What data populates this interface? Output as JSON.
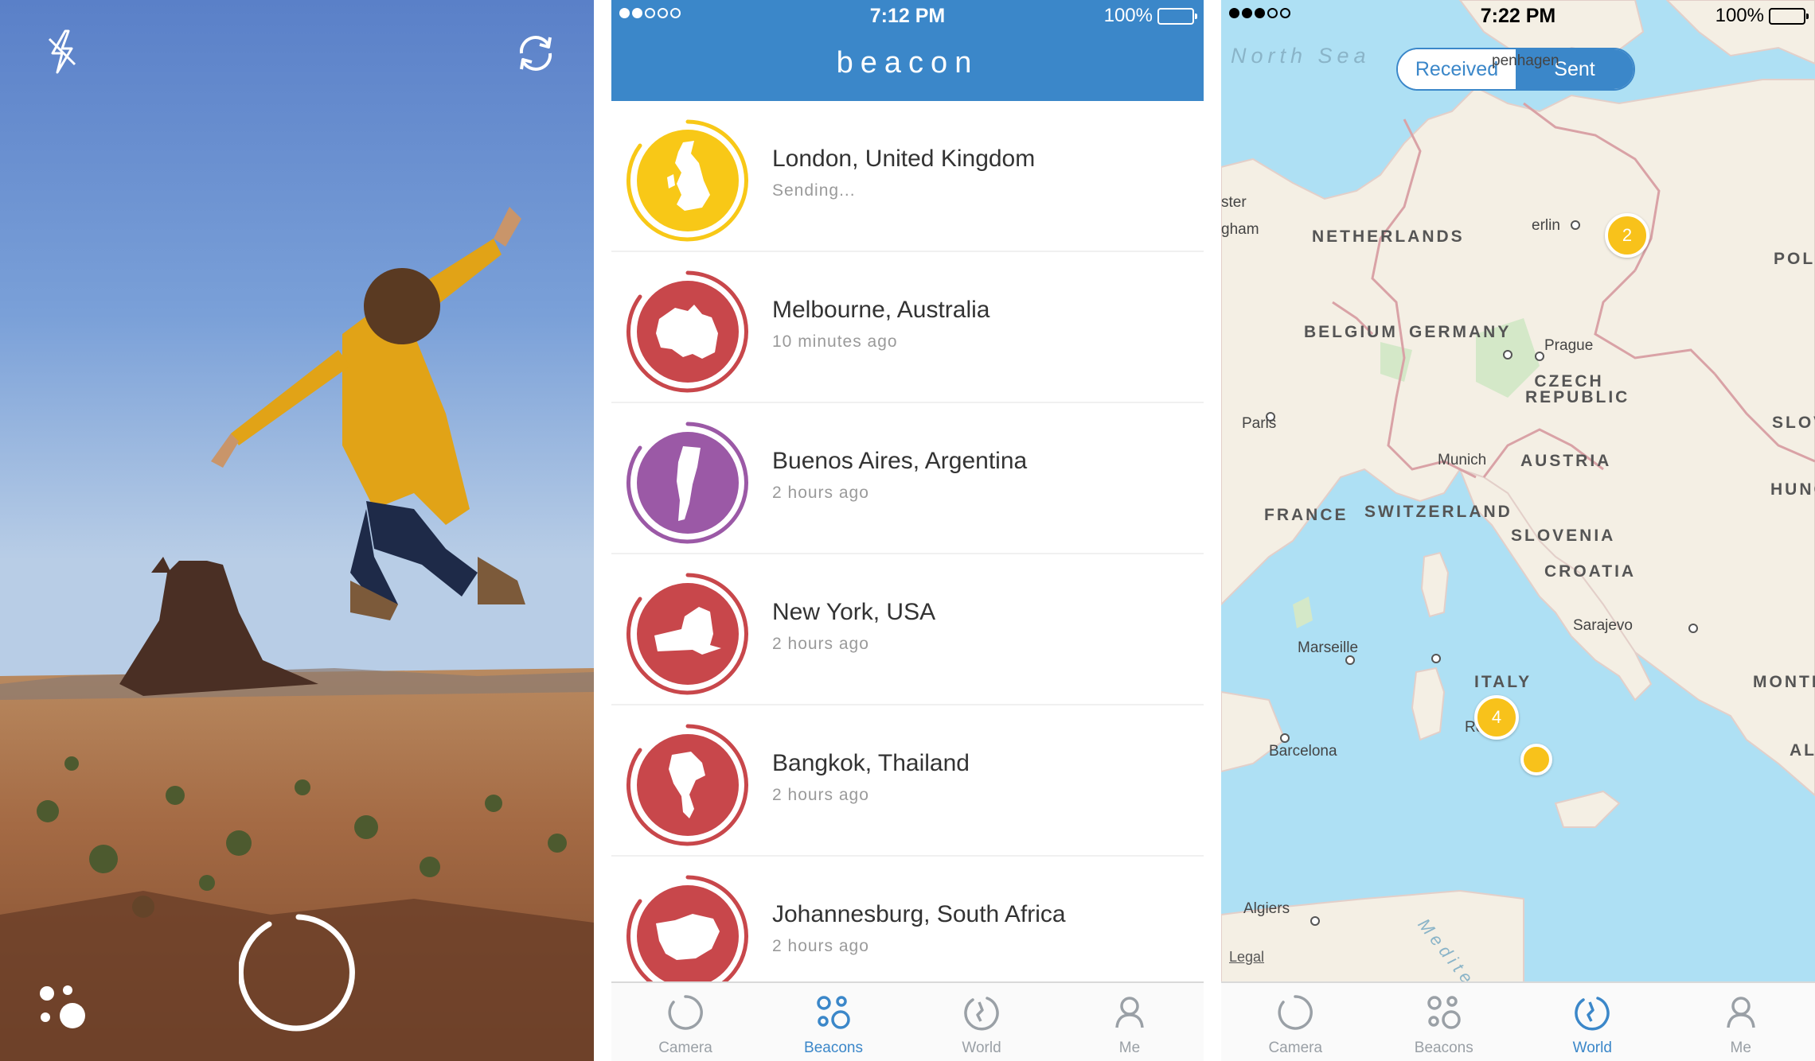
{
  "camera": {
    "icons": {
      "flash": "flash-off-icon",
      "flip": "camera-flip-icon",
      "shutter": "shutter-ring-icon",
      "filters": "filter-dots-icon"
    }
  },
  "beacons_screen": {
    "status_bar": {
      "time": "7:12 PM",
      "battery": "100%",
      "signal_bars": 2
    },
    "title": "beacon",
    "header_color": "#3b87c9",
    "items": [
      {
        "city": "London, United Kingdom",
        "sub": "Sending...",
        "color": "#f8c817",
        "icon": "united-kingdom-map-icon"
      },
      {
        "city": "Melbourne, Australia",
        "sub": "10 minutes ago",
        "color": "#c8474b",
        "icon": "australia-map-icon"
      },
      {
        "city": "Buenos Aires, Argentina",
        "sub": "2 hours ago",
        "color": "#9b59a6",
        "icon": "argentina-map-icon"
      },
      {
        "city": "New York, USA",
        "sub": "2 hours ago",
        "color": "#c8474b",
        "icon": "new-york-map-icon"
      },
      {
        "city": "Bangkok, Thailand",
        "sub": "2 hours ago",
        "color": "#c8474b",
        "icon": "thailand-map-icon"
      },
      {
        "city": "Johannesburg, South Africa",
        "sub": "2 hours ago",
        "color": "#c8474b",
        "icon": "south-africa-map-icon"
      }
    ],
    "tabs": [
      {
        "label": "Camera",
        "icon": "camera-ring-icon",
        "active": false
      },
      {
        "label": "Beacons",
        "icon": "beacons-dots-icon",
        "active": true
      },
      {
        "label": "World",
        "icon": "world-icon",
        "active": false
      },
      {
        "label": "Me",
        "icon": "person-icon",
        "active": false
      }
    ]
  },
  "world_screen": {
    "status_bar": {
      "time": "7:22 PM",
      "battery": "100%",
      "signal_bars": 3
    },
    "segment": {
      "received": "Received",
      "sent": "Sent",
      "selected": "Received"
    },
    "sea_labels": {
      "north_sea": "North Sea",
      "mediterranean": "Mediterranean Sea"
    },
    "countries": {
      "netherlands": "NETHERLANDS",
      "belgium": "BELGIUM",
      "germany": "GERMANY",
      "france": "FRANCE",
      "switzerland": "SWITZERLAND",
      "austria": "AUSTRIA",
      "czech": "CZECH REPUBLIC",
      "slovenia": "SLOVENIA",
      "croatia": "CROATIA",
      "italy": "ITALY",
      "poland": "POL",
      "slovakia": "SLOV",
      "hungary": "HUNG",
      "montenegro": "MONTE",
      "albania": "AL"
    },
    "cities": {
      "copenhagen": "penhagen",
      "berlin": "erlin",
      "prague": "Prague",
      "paris": "Paris",
      "munich": "Munich",
      "marseille": "Marseille",
      "barcelona": "Barcelona",
      "rome": "Ron",
      "sarajevo": "Sarajevo",
      "algiers": "Algiers",
      "edge1": "ster",
      "edge2": "gham"
    },
    "clusters": [
      {
        "label": "2",
        "place": "Berlin"
      },
      {
        "label": "4",
        "place": "Rome"
      }
    ],
    "legal": "Legal",
    "tabs": [
      {
        "label": "Camera",
        "icon": "camera-ring-icon",
        "active": false
      },
      {
        "label": "Beacons",
        "icon": "beacons-dots-icon",
        "active": false
      },
      {
        "label": "World",
        "icon": "world-icon",
        "active": true
      },
      {
        "label": "Me",
        "icon": "person-icon",
        "active": false
      }
    ]
  }
}
